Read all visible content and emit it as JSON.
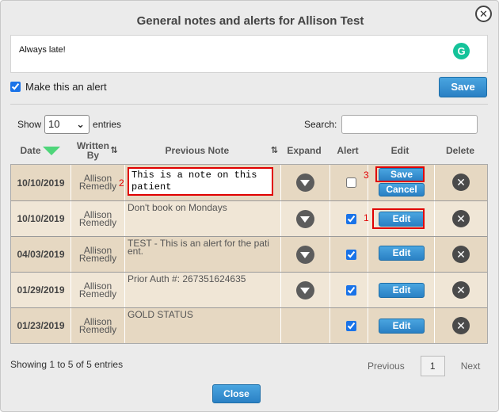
{
  "dialog": {
    "title": "General notes and alerts for Allison Test",
    "close_icon": "close-circle-icon",
    "note_value": "Always late!",
    "grammarly_glyph": "G",
    "make_alert_label": "Make this an alert",
    "make_alert_checked": true,
    "save_label": "Save",
    "close_label": "Close"
  },
  "table_controls": {
    "show_label": "Show",
    "page_size": "10",
    "entries_label": "entries",
    "search_label": "Search:",
    "search_value": ""
  },
  "columns": {
    "date": "Date",
    "written_by": "Written By",
    "previous_note": "Previous Note",
    "expand": "Expand",
    "alert": "Alert",
    "edit": "Edit",
    "delete": "Delete",
    "sort_glyph": "⇅"
  },
  "rows": [
    {
      "date": "10/10/2019",
      "author_first": "Allison",
      "author_last": "Remedly",
      "note": "This is a note on this patient",
      "alert": false,
      "editing": true,
      "save_label": "Save",
      "cancel_label": "Cancel"
    },
    {
      "date": "10/10/2019",
      "author_first": "Allison",
      "author_last": "Remedly",
      "note": "Don't book on Mondays",
      "alert": true,
      "edit_label": "Edit"
    },
    {
      "date": "04/03/2019",
      "author_first": "Allison",
      "author_last": "Remedly",
      "note": "TEST - This is an alert for the pati ent.",
      "alert": true,
      "edit_label": "Edit"
    },
    {
      "date": "01/29/2019",
      "author_first": "Allison",
      "author_last": "Remedly",
      "note": "Prior Auth #: 267351624635",
      "alert": true,
      "edit_label": "Edit"
    },
    {
      "date": "01/23/2019",
      "author_first": "Allison",
      "author_last": "Remedly",
      "note": "GOLD STATUS",
      "alert": true,
      "edit_label": "Edit"
    }
  ],
  "annotations": {
    "one": "1",
    "two": "2",
    "three": "3"
  },
  "footer": {
    "info": "Showing 1 to 5 of 5 entries",
    "previous": "Previous",
    "page": "1",
    "next": "Next"
  },
  "colors": {
    "accent": "#2a80c4",
    "highlight": "#e00000",
    "row_dark": "#e6d8c2",
    "row_light": "#f0e6d6"
  }
}
